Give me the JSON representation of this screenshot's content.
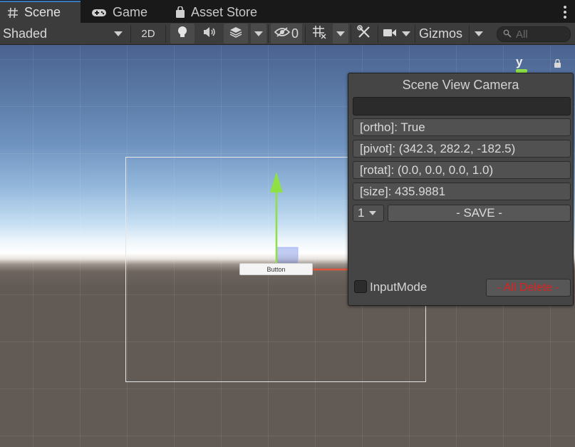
{
  "tabs": [
    {
      "label": "Scene",
      "icon": "hash-icon",
      "active": true
    },
    {
      "label": "Game",
      "icon": "gamepad-icon",
      "active": false
    },
    {
      "label": "Asset Store",
      "icon": "shopping-bag-icon",
      "active": false
    }
  ],
  "toolbar": {
    "shading_mode": "Shaded",
    "toggle_2d": "2D",
    "hidden_count": "0",
    "gizmos_label": "Gizmos",
    "search_placeholder": "All"
  },
  "scene": {
    "ui_button_label": "Button",
    "axis_label": "y"
  },
  "camera_panel": {
    "title": "Scene View Camera",
    "name_value": "",
    "ortho": "[ortho]: True",
    "pivot": "[pivot]: (342.3, 282.2, -182.5)",
    "rotat": "[rotat]: (0.0, 0.0, 0.0, 1.0)",
    "size": "[size]: 435.9881",
    "slot_value": "1",
    "save_label": "- SAVE -",
    "input_mode_label": "InputMode",
    "input_mode_checked": false,
    "delete_label": "- All Delete -"
  },
  "colors": {
    "accent": "#3a79bb",
    "y_axis": "#8ee045",
    "x_axis": "#e0533a",
    "delete_text": "#e02020"
  }
}
